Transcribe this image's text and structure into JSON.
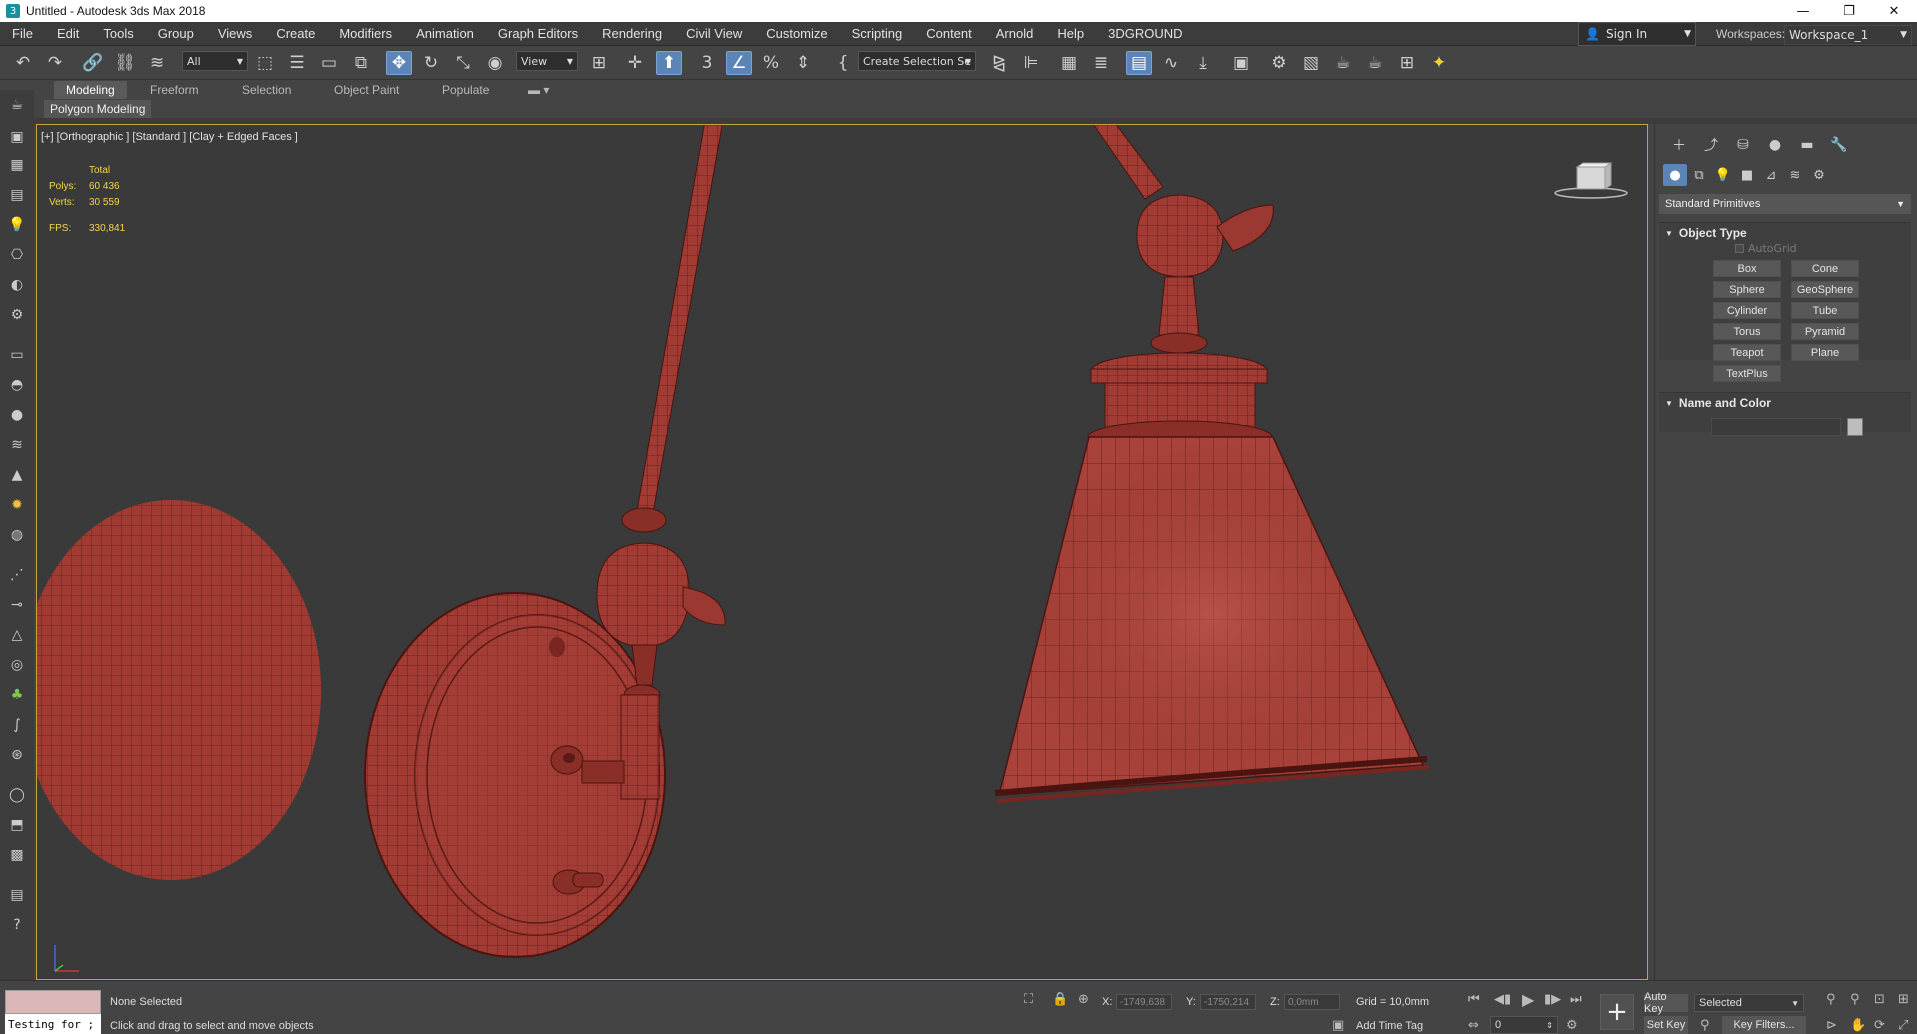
{
  "window": {
    "title": "Untitled - Autodesk 3ds Max 2018",
    "icon": "3",
    "minimize": "—",
    "restore": "❐",
    "close": "✕"
  },
  "menu": [
    "File",
    "Edit",
    "Tools",
    "Group",
    "Views",
    "Create",
    "Modifiers",
    "Animation",
    "Graph Editors",
    "Rendering",
    "Civil View",
    "Customize",
    "Scripting",
    "Content",
    "Arnold",
    "Help",
    "3DGROUND"
  ],
  "account": {
    "sign_in": "Sign In",
    "workspaces_label": "Workspaces:",
    "workspace": "Workspace_1"
  },
  "toolbar": {
    "selection_filter": "All",
    "ref_coord": "View",
    "named_selection": "Create Selection Se"
  },
  "ribbon": {
    "tabs": [
      "Modeling",
      "Freeform",
      "Selection",
      "Object Paint",
      "Populate"
    ],
    "active_tab": "Modeling",
    "sub": "Polygon Modeling"
  },
  "viewport": {
    "label": "[+] [Orthographic ] [Standard ] [Clay + Edged Faces ]",
    "stats_header": "Total",
    "polys_label": "Polys:",
    "polys": "60 436",
    "verts_label": "Verts:",
    "verts": "30 559",
    "fps_label": "FPS:",
    "fps": "330,841",
    "model_color": "#a03a32",
    "wire_color": "#5a1a16"
  },
  "command_panel": {
    "category": "Standard Primitives",
    "object_type_title": "Object Type",
    "autogrid": "AutoGrid",
    "buttons": [
      "Box",
      "Cone",
      "Sphere",
      "GeoSphere",
      "Cylinder",
      "Tube",
      "Torus",
      "Pyramid",
      "Teapot",
      "Plane",
      "TextPlus"
    ],
    "name_color_title": "Name and Color"
  },
  "status": {
    "maxscript_input": "Testing for ;",
    "selection": "None Selected",
    "prompt": "Click and drag to select and move objects",
    "x_label": "X:",
    "x": "-1749,638",
    "y_label": "Y:",
    "y": "-1750,214",
    "z_label": "Z:",
    "z": "0,0mm",
    "grid": "Grid = 10,0mm",
    "add_time_tag": "Add Time Tag",
    "auto_key": "Auto Key",
    "set_key": "Set Key",
    "key_mode": "Selected",
    "key_filters": "Key Filters...",
    "frame": "0"
  }
}
